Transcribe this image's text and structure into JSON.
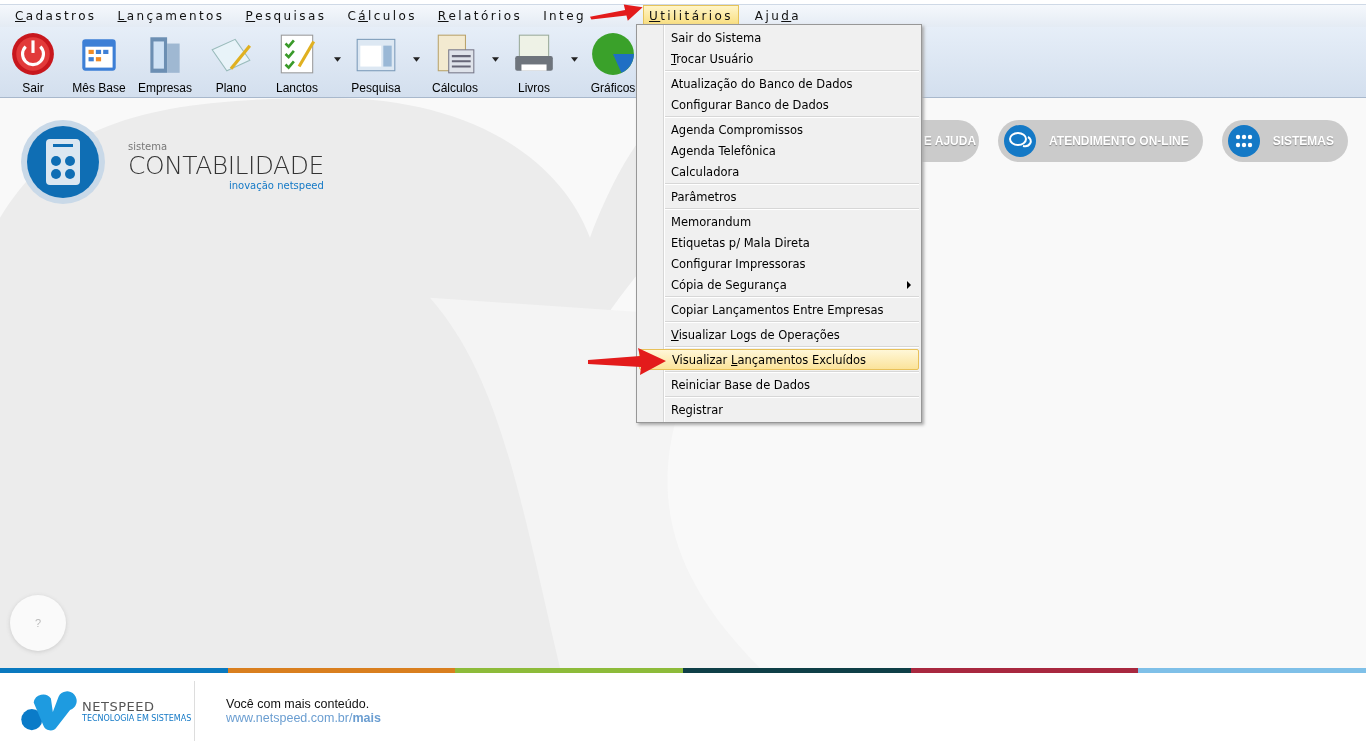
{
  "menu_bar": [
    {
      "label_parts": [
        {
          "text": "C",
          "underlined": true
        },
        {
          "text": "adastros",
          "underlined": false
        }
      ],
      "selected": false
    },
    {
      "label_parts": [
        {
          "text": "L",
          "underlined": true
        },
        {
          "text": "ançamentos",
          "underlined": false
        }
      ],
      "selected": false
    },
    {
      "label_parts": [
        {
          "text": "P",
          "underlined": true
        },
        {
          "text": "esquisas",
          "underlined": false
        }
      ],
      "selected": false
    },
    {
      "label_parts": [
        {
          "text": "C",
          "underlined": false
        },
        {
          "text": "á",
          "underlined": true
        },
        {
          "text": "lculos",
          "underlined": false
        }
      ],
      "selected": false
    },
    {
      "label_parts": [
        {
          "text": "R",
          "underlined": true
        },
        {
          "text": "elatórios",
          "underlined": false
        }
      ],
      "selected": false
    },
    {
      "label_parts": [
        {
          "text": "Integ",
          "underlined": false
        }
      ],
      "selected": false
    },
    {
      "label_parts": [
        {
          "text": "U",
          "underlined": true
        },
        {
          "text": "tilitários",
          "underlined": false
        }
      ],
      "selected": true
    },
    {
      "label_parts": [
        {
          "text": "Aju",
          "underlined": false
        },
        {
          "text": "d",
          "underlined": true
        },
        {
          "text": "a",
          "underlined": false
        }
      ],
      "selected": false
    }
  ],
  "toolbar": [
    {
      "label": "Sair",
      "dropdown": false
    },
    {
      "label": "Mês Base",
      "dropdown": false
    },
    {
      "label": "Empresas",
      "dropdown": false
    },
    {
      "label": "Plano",
      "dropdown": false
    },
    {
      "label": "Lanctos",
      "dropdown": true
    },
    {
      "label": "Pesquisa",
      "dropdown": true
    },
    {
      "label": "Cálculos",
      "dropdown": true
    },
    {
      "label": "Livros",
      "dropdown": true
    },
    {
      "label": "Gráficos",
      "dropdown": false
    }
  ],
  "utilities_menu": [
    [
      {
        "label_parts": [
          {
            "text": "Sair do Sistema",
            "underlined": false
          }
        ],
        "selected": false,
        "submenu": false
      },
      {
        "label_parts": [
          {
            "text": "T",
            "underlined": true
          },
          {
            "text": "rocar Usuário",
            "underlined": false
          }
        ],
        "selected": false,
        "submenu": false
      }
    ],
    [
      {
        "label_parts": [
          {
            "text": "Atualização do Banco de Dados",
            "underlined": false
          }
        ],
        "selected": false,
        "submenu": false
      },
      {
        "label_parts": [
          {
            "text": "Configurar Banco de Dados",
            "underlined": false
          }
        ],
        "selected": false,
        "submenu": false
      }
    ],
    [
      {
        "label_parts": [
          {
            "text": "Agenda Compromissos",
            "underlined": false
          }
        ],
        "selected": false,
        "submenu": false
      },
      {
        "label_parts": [
          {
            "text": "Agenda Telefônica",
            "underlined": false
          }
        ],
        "selected": false,
        "submenu": false
      },
      {
        "label_parts": [
          {
            "text": "Calculadora",
            "underlined": false
          }
        ],
        "selected": false,
        "submenu": false
      }
    ],
    [
      {
        "label_parts": [
          {
            "text": "Parâmetros",
            "underlined": false
          }
        ],
        "selected": false,
        "submenu": false
      }
    ],
    [
      {
        "label_parts": [
          {
            "text": "Memorandum",
            "underlined": false
          }
        ],
        "selected": false,
        "submenu": false
      },
      {
        "label_parts": [
          {
            "text": "Etiquetas p/ Mala Direta",
            "underlined": false
          }
        ],
        "selected": false,
        "submenu": false
      },
      {
        "label_parts": [
          {
            "text": "Configurar Impressoras",
            "underlined": false
          }
        ],
        "selected": false,
        "submenu": false
      },
      {
        "label_parts": [
          {
            "text": "Cópia de Segurança",
            "underlined": false
          }
        ],
        "selected": false,
        "submenu": true
      }
    ],
    [
      {
        "label_parts": [
          {
            "text": "Copiar Lançamentos Entre Empresas",
            "underlined": false
          }
        ],
        "selected": false,
        "submenu": false
      }
    ],
    [
      {
        "label_parts": [
          {
            "text": "V",
            "underlined": true
          },
          {
            "text": "isualizar Logs de Operações",
            "underlined": false
          }
        ],
        "selected": false,
        "submenu": false
      }
    ],
    [
      {
        "label_parts": [
          {
            "text": "Visualizar ",
            "underlined": false
          },
          {
            "text": "L",
            "underlined": true
          },
          {
            "text": "ançamentos Excluídos",
            "underlined": false
          }
        ],
        "selected": true,
        "submenu": false
      }
    ],
    [
      {
        "label_parts": [
          {
            "text": "Reiniciar Base de Dados",
            "underlined": false
          }
        ],
        "selected": false,
        "submenu": false
      }
    ],
    [
      {
        "label_parts": [
          {
            "text": "Registrar",
            "underlined": false
          }
        ],
        "selected": false,
        "submenu": false
      }
    ]
  ],
  "logo": {
    "kicker": "sistema",
    "title": "CONTABILIDADE",
    "tagline": "inovação netspeed"
  },
  "header_buttons": [
    {
      "label": "E AJUDA"
    },
    {
      "label": "ATENDIMENTO ON-LINE"
    },
    {
      "label": "SISTEMAS"
    }
  ],
  "help_button": "?",
  "footer": {
    "brand": "NETSPEED",
    "brand_tagline": "TECNOLOGIA EM SISTEMAS",
    "message": "Você com mais conteúdo.",
    "link": "www.netspeed.com.br/**mais**"
  }
}
